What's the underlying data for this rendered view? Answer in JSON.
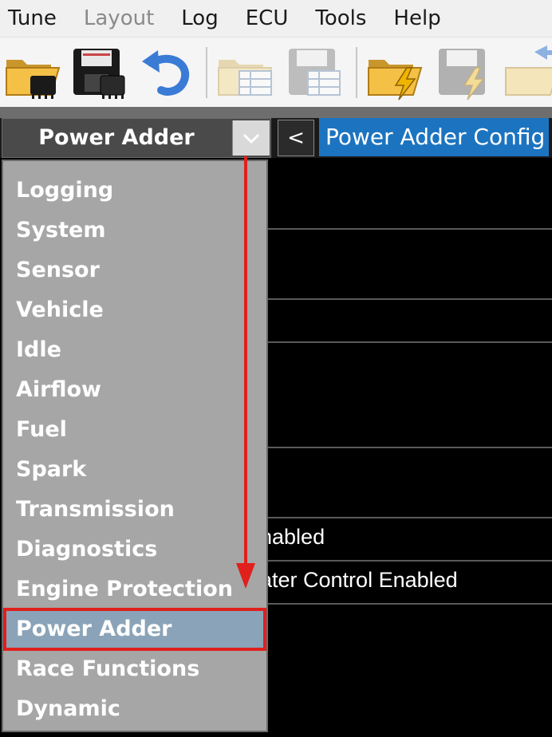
{
  "menubar": {
    "items": [
      {
        "label": "Tune",
        "enabled": true
      },
      {
        "label": "Layout",
        "enabled": false
      },
      {
        "label": "Log",
        "enabled": true
      },
      {
        "label": "ECU",
        "enabled": true
      },
      {
        "label": "Tools",
        "enabled": true
      },
      {
        "label": "Help",
        "enabled": true
      }
    ]
  },
  "toolbar": {
    "buttons": [
      {
        "icon": "open-folder-chip-icon"
      },
      {
        "icon": "save-disk-chip-icon"
      },
      {
        "icon": "undo-icon"
      },
      {
        "icon": "open-folder-table-icon"
      },
      {
        "icon": "save-disk-table-icon"
      },
      {
        "icon": "open-folder-lightning-icon"
      },
      {
        "icon": "save-disk-lightning-icon"
      },
      {
        "icon": "import-folder-arrow-icon"
      }
    ]
  },
  "selector": {
    "current": "Power Adder",
    "back_label": "<",
    "page_title": "Power Adder Config"
  },
  "dropdown": {
    "items": [
      "Logging",
      "System",
      "Sensor",
      "Vehicle",
      "Idle",
      "Airflow",
      "Fuel",
      "Spark",
      "Transmission",
      "Diagnostics",
      "Engine Protection",
      "Power Adder",
      "Race Functions",
      "Dynamic"
    ],
    "selected": "Power Adder"
  },
  "content": {
    "rows": [
      "nabled",
      "ater Control Enabled"
    ]
  },
  "colors": {
    "accent": "#1c74c0",
    "annotation": "#e0201c",
    "dropdown_bg": "#a6a6a6",
    "selected_bg": "#8aa3b8"
  }
}
